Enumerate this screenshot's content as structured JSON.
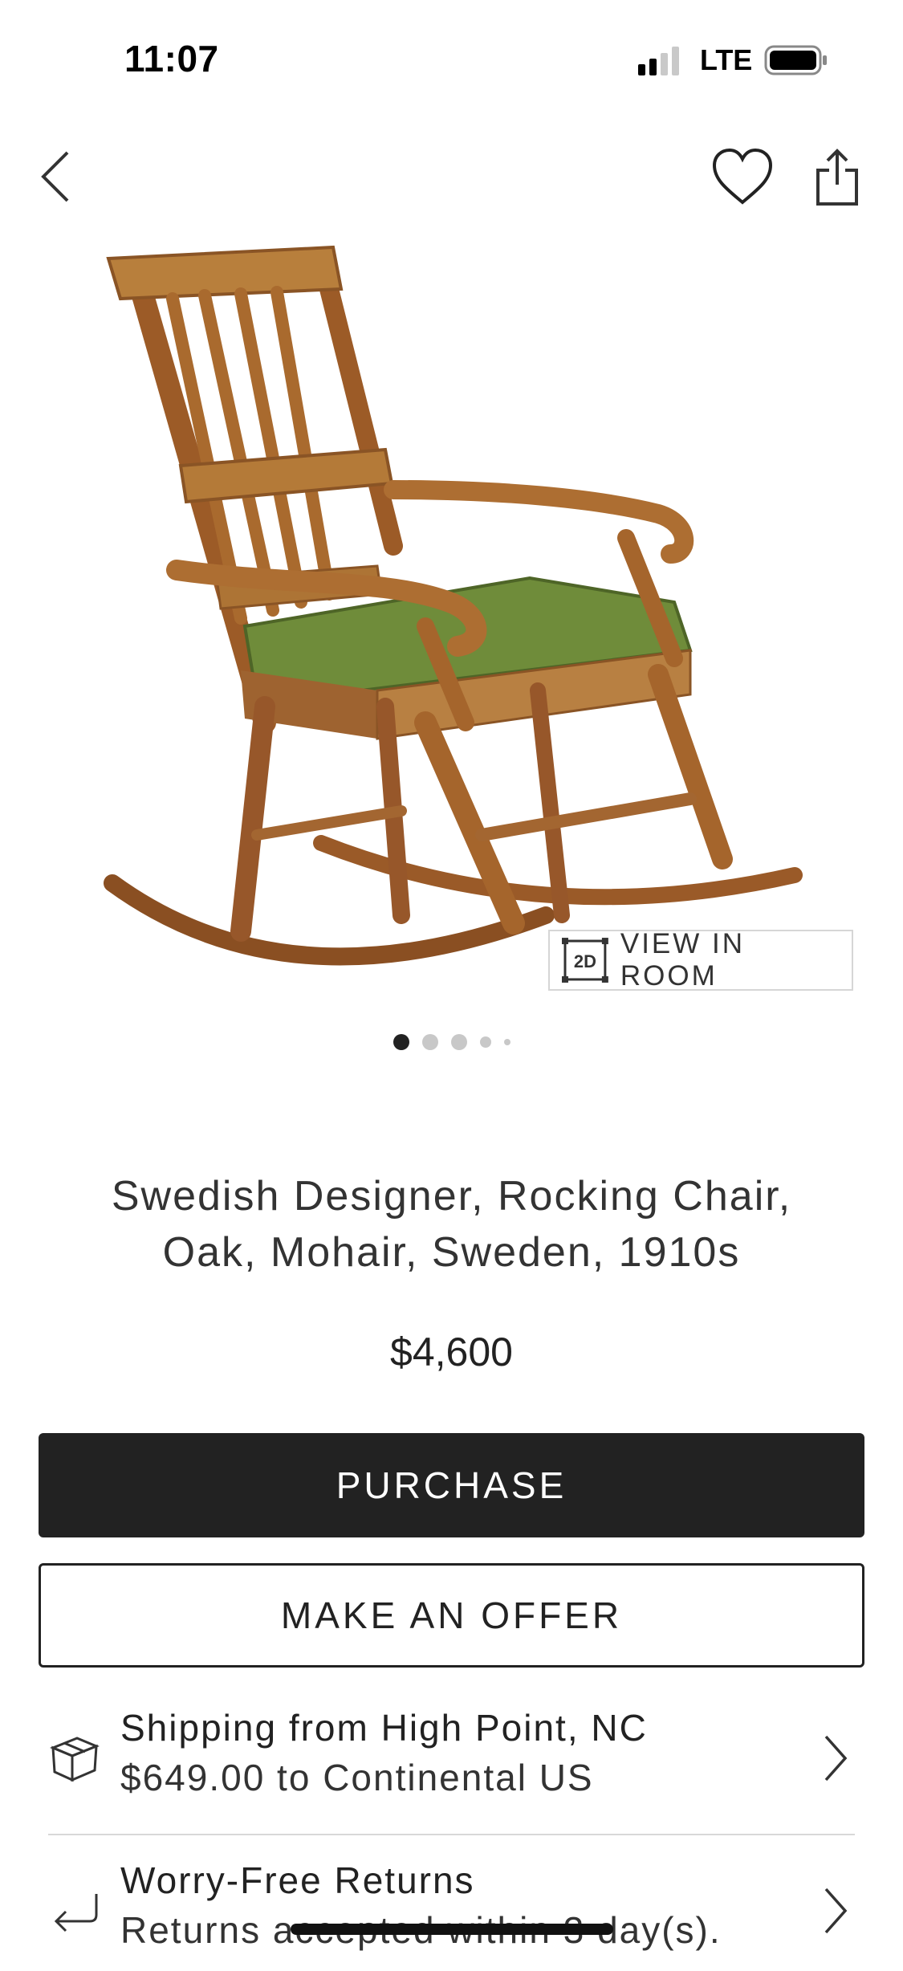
{
  "status_bar": {
    "time": "11:07",
    "network": "LTE"
  },
  "nav": {
    "back_icon": "chevron-left-icon",
    "favorite_icon": "heart-icon",
    "share_icon": "share-icon"
  },
  "product": {
    "title_line1": "Swedish Designer, Rocking Chair,",
    "title_line2": "Oak, Mohair, Sweden, 1910s",
    "price": "$4,600",
    "image_count": 5,
    "current_image": 1
  },
  "view_in_room": {
    "badge": "2D",
    "label": "VIEW IN ROOM"
  },
  "actions": {
    "purchase": "PURCHASE",
    "offer": "MAKE AN OFFER"
  },
  "shipping": {
    "title": "Shipping from High Point, NC",
    "detail": "$649.00 to Continental US",
    "icon": "box-icon"
  },
  "returns": {
    "title": "Worry-Free Returns",
    "detail": "Returns accepted within 3 day(s).",
    "icon": "return-arrow-icon"
  },
  "colors": {
    "primary": "#222222",
    "seat_green": "#6f8c3a",
    "oak": "#b8783a"
  }
}
